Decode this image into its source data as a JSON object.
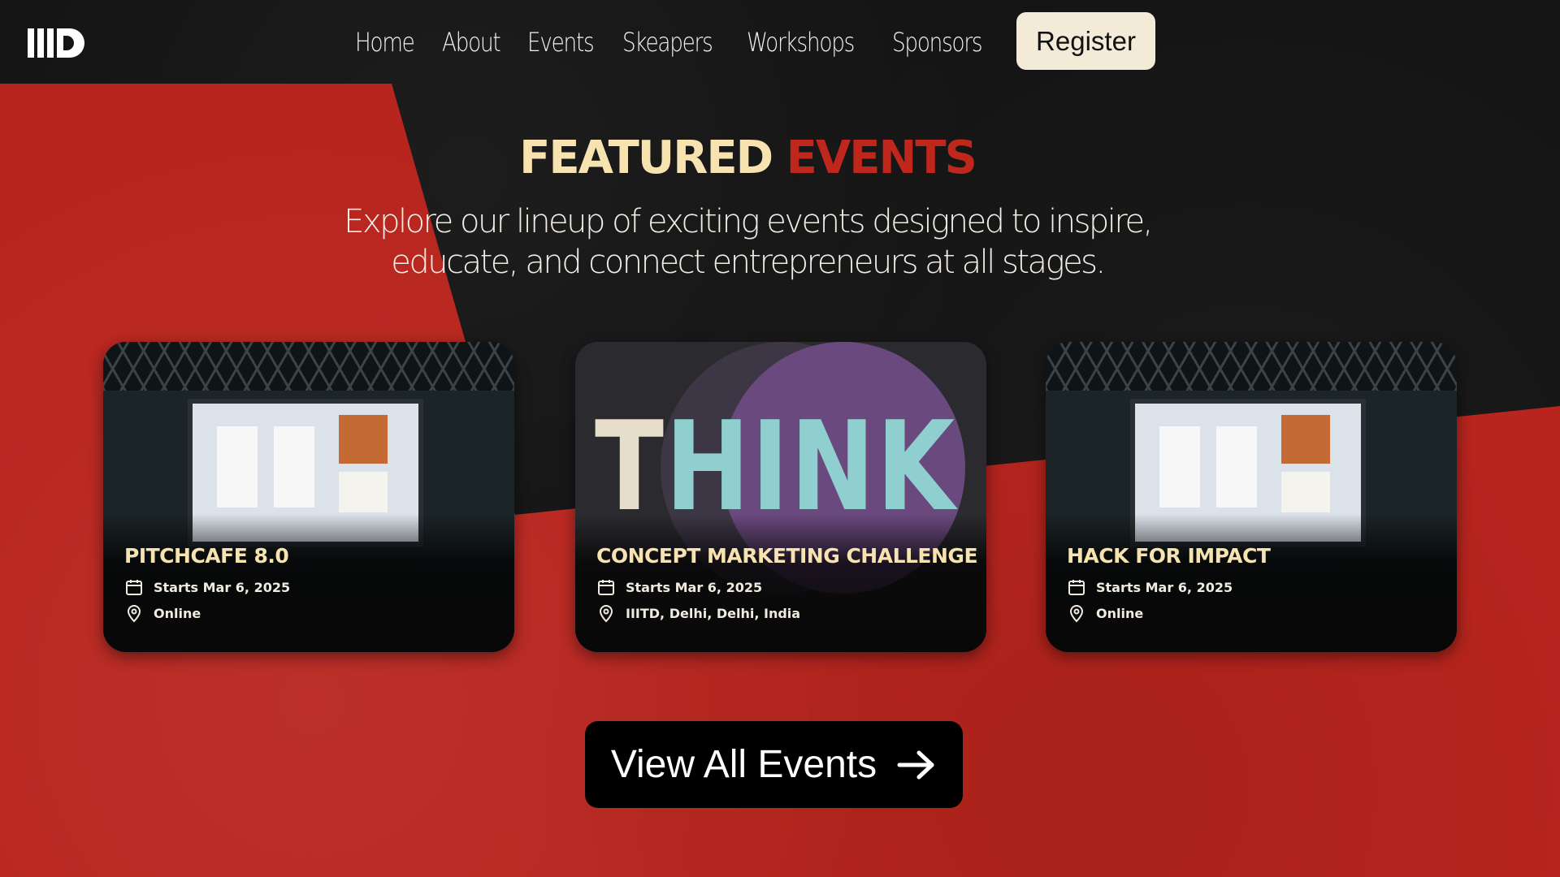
{
  "colors": {
    "accent_red": "#b8251e",
    "title_cream": "#f6e3b0",
    "title_red": "#c0271c",
    "register_bg": "#f3ead7",
    "background_black": "#141414"
  },
  "nav": {
    "logo_icon": "iiitd-logo-icon",
    "links": [
      "Home",
      "About",
      "Events",
      "Skeapers",
      "Workshops",
      "Sponsors"
    ],
    "register_label": "Register"
  },
  "featured": {
    "title_part1": "FEATURED",
    "title_part2": "EVENTS",
    "subtitle": "Explore our lineup of exciting events designed to inspire, educate, and connect entrepreneurs at all stages."
  },
  "events": [
    {
      "title": "PITCHCAFE 8.0",
      "date": "Starts Mar 6, 2025",
      "location": "Online",
      "image": "conference-stage-image"
    },
    {
      "title": "CONCEPT MARKETING CHALLENGE",
      "date": "Starts Mar 6, 2025",
      "location": "IIITD, Delhi, Delhi, India",
      "image": "think-poster-image",
      "poster_word_a": "T",
      "poster_word_b": "HINK"
    },
    {
      "title": "HACK FOR IMPACT",
      "date": "Starts Mar 6, 2025",
      "location": "Online",
      "image": "conference-stage-image"
    }
  ],
  "icons": {
    "date": "calendar-icon",
    "location": "map-pin-icon",
    "arrow": "arrow-right-icon"
  },
  "cta": {
    "view_all_label": "View All Events"
  }
}
